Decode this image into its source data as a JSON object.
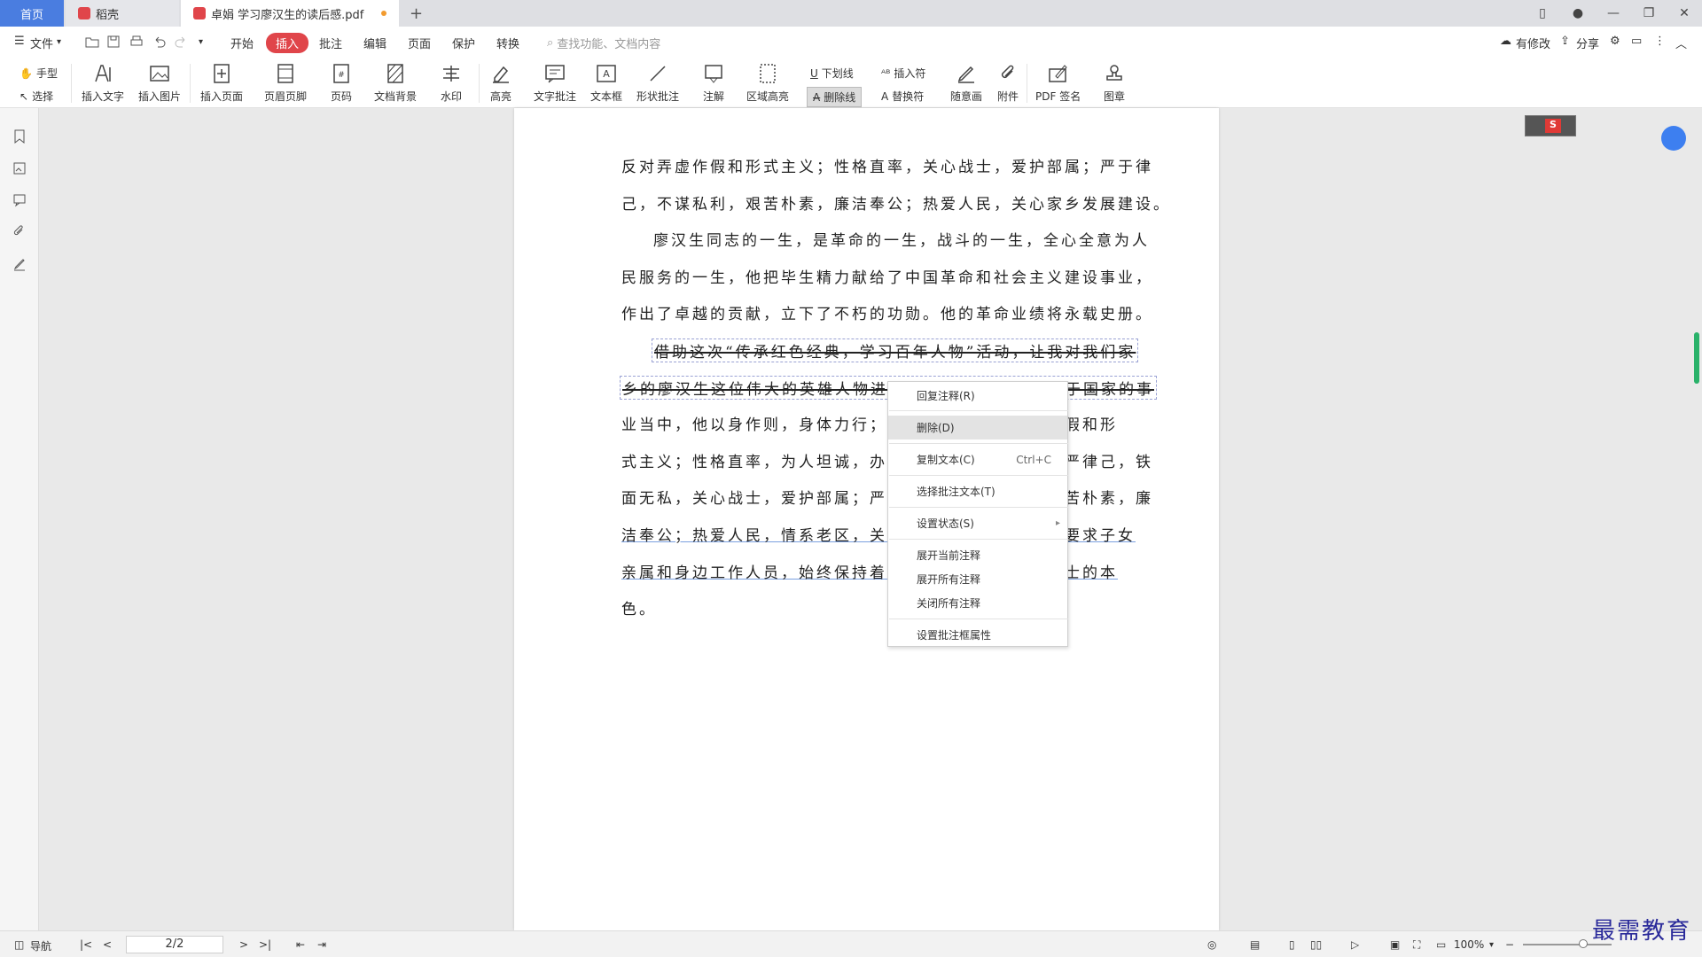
{
  "tabs": {
    "home": "首页",
    "daoke": "稻壳",
    "doc": "卓娟 学习廖汉生的读后感.pdf",
    "add": "+"
  },
  "menu": {
    "file": "文件",
    "start": "开始",
    "insert": "插入",
    "comment": "批注",
    "edit": "编辑",
    "page": "页面",
    "protect": "保护",
    "convert": "转换",
    "search_placeholder": "查找功能、文档内容",
    "has_changes": "有修改",
    "share": "分享"
  },
  "ribbon": {
    "hand": "手型",
    "select": "选择",
    "insert_text": "插入文字",
    "insert_image": "插入图片",
    "insert_page": "插入页面",
    "header_footer": "页眉页脚",
    "page_number": "页码",
    "doc_background": "文档背景",
    "watermark": "水印",
    "highlight": "高亮",
    "text_comment": "文字批注",
    "text_box": "文本框",
    "shape_comment": "形状批注",
    "annotation": "注解",
    "area_highlight": "区域高亮",
    "underline": "下划线",
    "strikethrough": "删除线",
    "insert_char": "插入符",
    "replace_char": "替换符",
    "freehand": "随意画",
    "attachment": "附件",
    "pdf_sign": "PDF 签名",
    "stamp": "图章"
  },
  "document": {
    "lines": [
      "反对弄虚作假和形式主义；性格直率，关心战士，爱护部属；严于律",
      "己，不谋私利，艰苦朴素，廉洁奉公；热爱人民，关心家乡发展建设。",
      "廖汉生同志的一生，是革命的一生，战斗的一生，全心全意为人",
      "民服务的一生，他把毕生精力献给了中国革命和社会主义建设事业，",
      "作出了卓越的贡献，立下了不朽的功勋。他的革命业绩将永载史册。",
      "借助这次“传承红色经典，学习百年人物”活动，让我对我们家",
      "乡的廖汉生这位伟大的英雄人物进行学习，他一生都投身于国家的事",
      "业当中，他以身作则，身体力行；崇尚实干，反对弄虚作假和形",
      "式主义；性格直率，为人坦诚，办事公道，严守党纪，从严律己，铁",
      "面无私，关心战士，爱护部属；严于律己，不谋私利，艰苦朴素，廉",
      "洁奉公；热爱人民，情系老区，关心家乡发展建设，严格要求子女",
      "亲属和身边工作人员，始终保持着一名共产党员和革命战士的本",
      "色。"
    ]
  },
  "context_menu": {
    "reply": "回复注释(R)",
    "delete": "删除(D)",
    "copy": "复制文本(C)",
    "copy_shortcut": "Ctrl+C",
    "select_text": "选择批注文本(T)",
    "set_status": "设置状态(S)",
    "expand_current": "展开当前注释",
    "expand_all": "展开所有注释",
    "close_all": "关闭所有注释",
    "properties": "设置批注框属性"
  },
  "status": {
    "nav": "导航",
    "page_indicator": "2/2",
    "zoom": "100%"
  },
  "watermark_text": "最需教育",
  "colors": {
    "accent_red": "#e0454a",
    "tab_blue": "#4a7de0",
    "scroll_green": "#2ab26a"
  }
}
